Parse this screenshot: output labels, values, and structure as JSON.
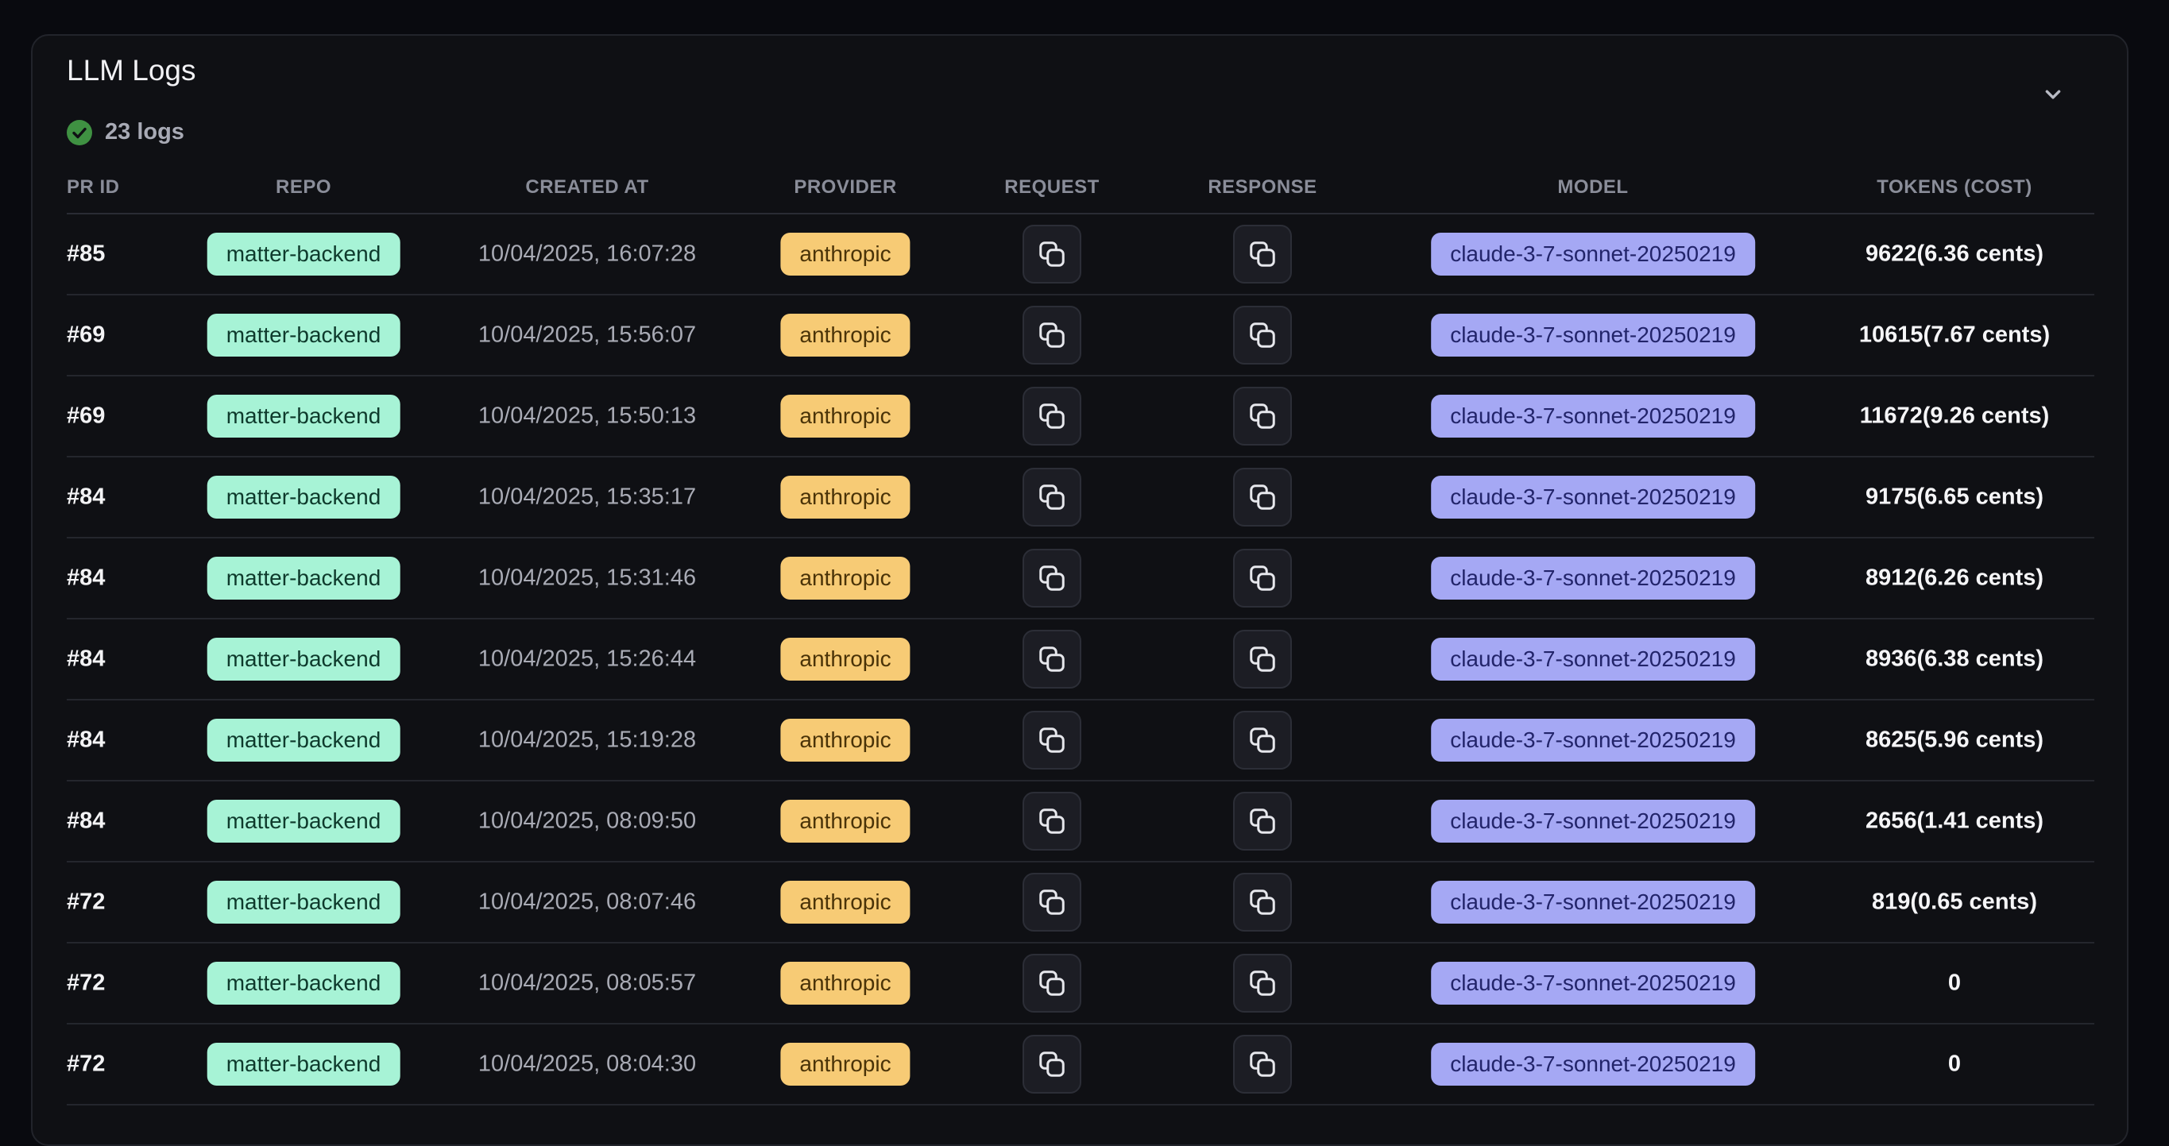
{
  "panel": {
    "title": "LLM Logs",
    "status": "23 logs"
  },
  "colors": {
    "success": "#3f9142",
    "repo_pill": "#a7f3d6",
    "provider_pill": "#f7cb75",
    "model_pill": "#a5a8f4"
  },
  "icons": {
    "status": "check-circle-icon",
    "collapse": "chevron-down-icon",
    "copy": "copy-icon"
  },
  "columns": [
    "PR ID",
    "REPO",
    "CREATED AT",
    "PROVIDER",
    "REQUEST",
    "RESPONSE",
    "MODEL",
    "TOKENS (COST)"
  ],
  "rows": [
    {
      "pr_id": "#85",
      "repo": "matter-backend",
      "created_at": "10/04/2025, 16:07:28",
      "provider": "anthropic",
      "model": "claude-3-7-sonnet-20250219",
      "tokens": "9622(6.36 cents)"
    },
    {
      "pr_id": "#69",
      "repo": "matter-backend",
      "created_at": "10/04/2025, 15:56:07",
      "provider": "anthropic",
      "model": "claude-3-7-sonnet-20250219",
      "tokens": "10615(7.67 cents)"
    },
    {
      "pr_id": "#69",
      "repo": "matter-backend",
      "created_at": "10/04/2025, 15:50:13",
      "provider": "anthropic",
      "model": "claude-3-7-sonnet-20250219",
      "tokens": "11672(9.26 cents)"
    },
    {
      "pr_id": "#84",
      "repo": "matter-backend",
      "created_at": "10/04/2025, 15:35:17",
      "provider": "anthropic",
      "model": "claude-3-7-sonnet-20250219",
      "tokens": "9175(6.65 cents)"
    },
    {
      "pr_id": "#84",
      "repo": "matter-backend",
      "created_at": "10/04/2025, 15:31:46",
      "provider": "anthropic",
      "model": "claude-3-7-sonnet-20250219",
      "tokens": "8912(6.26 cents)"
    },
    {
      "pr_id": "#84",
      "repo": "matter-backend",
      "created_at": "10/04/2025, 15:26:44",
      "provider": "anthropic",
      "model": "claude-3-7-sonnet-20250219",
      "tokens": "8936(6.38 cents)"
    },
    {
      "pr_id": "#84",
      "repo": "matter-backend",
      "created_at": "10/04/2025, 15:19:28",
      "provider": "anthropic",
      "model": "claude-3-7-sonnet-20250219",
      "tokens": "8625(5.96 cents)"
    },
    {
      "pr_id": "#84",
      "repo": "matter-backend",
      "created_at": "10/04/2025, 08:09:50",
      "provider": "anthropic",
      "model": "claude-3-7-sonnet-20250219",
      "tokens": "2656(1.41 cents)"
    },
    {
      "pr_id": "#72",
      "repo": "matter-backend",
      "created_at": "10/04/2025, 08:07:46",
      "provider": "anthropic",
      "model": "claude-3-7-sonnet-20250219",
      "tokens": "819(0.65 cents)"
    },
    {
      "pr_id": "#72",
      "repo": "matter-backend",
      "created_at": "10/04/2025, 08:05:57",
      "provider": "anthropic",
      "model": "claude-3-7-sonnet-20250219",
      "tokens": "0"
    },
    {
      "pr_id": "#72",
      "repo": "matter-backend",
      "created_at": "10/04/2025, 08:04:30",
      "provider": "anthropic",
      "model": "claude-3-7-sonnet-20250219",
      "tokens": "0"
    }
  ]
}
